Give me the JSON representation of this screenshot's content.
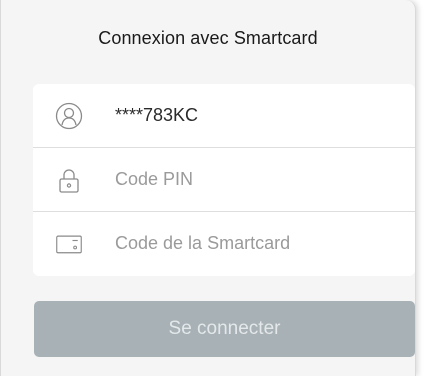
{
  "dialog": {
    "title": "Connexion avec Smartcard"
  },
  "form": {
    "user_value": "****783KC",
    "pin_placeholder": "Code PIN",
    "smartcard_placeholder": "Code de la Smartcard"
  },
  "icons": {
    "user": "user-icon",
    "pin": "lock-icon",
    "smartcard": "card-icon"
  },
  "button": {
    "label": "Se connecter",
    "state": "disabled"
  },
  "colors": {
    "button_bg": "#a7b1b6",
    "button_text": "#e4e8ea",
    "panel_bg": "#f5f5f5",
    "input_bg": "#ffffff"
  }
}
